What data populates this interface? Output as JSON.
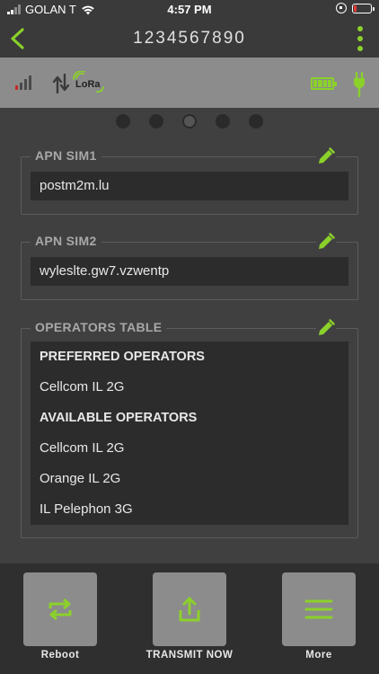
{
  "status_bar": {
    "carrier": "GOLAN T",
    "time": "4:57 PM"
  },
  "nav": {
    "title": "1234567890"
  },
  "info_bar": {
    "lora_label": "LoRa"
  },
  "pager": {
    "count": 5,
    "active_index": 2
  },
  "apn_sim1": {
    "title": "APN SIM1",
    "value": "postm2m.lu"
  },
  "apn_sim2": {
    "title": "APN SIM2",
    "value": "wyleslte.gw7.vzwentp"
  },
  "operators_table": {
    "title": "OPERATORS TABLE",
    "preferred_header": "PREFERRED OPERATORS",
    "preferred": [
      "Cellcom IL 2G"
    ],
    "available_header": "AVAILABLE OPERATORS",
    "available": [
      "Cellcom IL 2G",
      "Orange IL 2G",
      "IL Pelephon 3G"
    ]
  },
  "bottom_bar": {
    "reboot_label": "Reboot",
    "transmit_label": "TRANSMIT NOW",
    "more_label": "More"
  },
  "colors": {
    "accent": "#8bd12a",
    "background": "#404040",
    "field_background": "#2c2c2c",
    "button_background": "#8c8c8c"
  },
  "icons": [
    "wifi-icon",
    "back-arrow-icon",
    "kebab-menu-icon",
    "signal-strength-icon",
    "transfer-arrows-icon",
    "lora-icon",
    "battery-icon",
    "plug-icon",
    "edit-pencil-icon",
    "reboot-cycle-icon",
    "share-upload-icon",
    "hamburger-menu-icon"
  ]
}
